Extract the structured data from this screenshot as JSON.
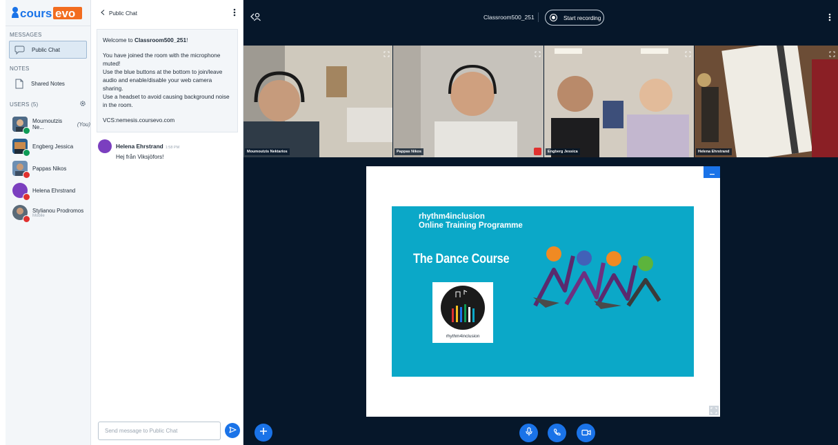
{
  "brand": {
    "logo_text_left": "cours",
    "logo_text_right": "evo"
  },
  "sidebar": {
    "messages_label": "MESSAGES",
    "public_chat_label": "Public Chat",
    "notes_label": "NOTES",
    "shared_notes_label": "Shared Notes",
    "users_label": "USERS (5)",
    "users": [
      {
        "name": "Moumoutzis Ne...",
        "suffix": "(You)",
        "status": "green",
        "sub": ""
      },
      {
        "name": "Engberg Jessica",
        "suffix": "",
        "status": "green",
        "sub": ""
      },
      {
        "name": "Pappas Nikos",
        "suffix": "",
        "status": "red",
        "sub": ""
      },
      {
        "name": "Helena Ehrstrand",
        "suffix": "",
        "status": "red",
        "sub": ""
      },
      {
        "name": "Stylianou Prodromos",
        "suffix": "",
        "status": "red",
        "sub": "Mobile"
      }
    ]
  },
  "chat": {
    "header_title": "Public Chat",
    "welcome_prefix": "Welcome to ",
    "welcome_room": "Classroom500_251",
    "welcome_suffix": "!",
    "welcome_lines": [
      "You have joined the room with the microphone muted!",
      "Use the blue buttons at the bottom to join/leave audio and enable/disable your web camera sharing.",
      "Use a headset to avoid causing background noise in the room."
    ],
    "welcome_vcs": "VCS:nemesis.coursevo.com",
    "messages": [
      {
        "author": "Helena Ehrstrand",
        "time": "1:58 PM",
        "text": "Hej från Viksjöfors!"
      }
    ],
    "input_placeholder": "Send message to Public Chat"
  },
  "meeting": {
    "room_title": "Classroom500_251",
    "record_label": "Start recording",
    "tiles": [
      {
        "name": "Moumoutzis Nektarios",
        "muted": false
      },
      {
        "name": "Pappas Nikos",
        "muted": true
      },
      {
        "name": "Engberg Jessica",
        "muted": true
      },
      {
        "name": "Helena Ehrstrand",
        "muted": true
      }
    ]
  },
  "presentation": {
    "line1": "rhythm4inclusion",
    "line2": "Online Training Programme",
    "course_title": "The Dance Course",
    "logo_caption": "rhythm4inclusion"
  },
  "colors": {
    "primary": "#1a73e8",
    "meeting_bg": "#06172a",
    "slide_bg": "#0ba8c8",
    "online": "#0e9b56",
    "muted": "#e0312f"
  }
}
